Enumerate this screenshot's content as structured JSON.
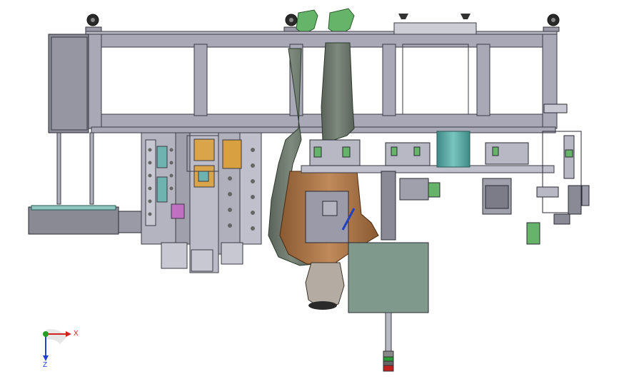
{
  "triad": {
    "x_label": "X",
    "z_label": "Z",
    "x_color": "#d42020",
    "y_color": "#20a020",
    "z_color": "#2040d0"
  },
  "colors": {
    "frame": "#9a9aa8",
    "frame_dark": "#55555f",
    "cable_chain": "#6e7a6e",
    "robot_base": "#b07a4a",
    "control_box": "#7f9a8c",
    "cylinder": "#5aa6a0",
    "green_part": "#66b36a",
    "orange_part": "#d8a040"
  }
}
